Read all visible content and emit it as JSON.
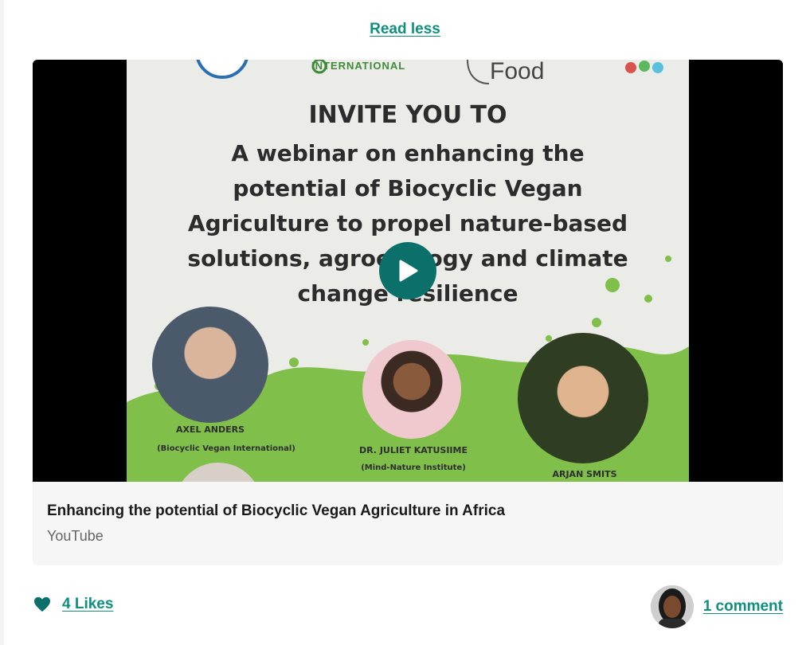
{
  "post": {
    "read_less_label": "Read less"
  },
  "embed": {
    "title": "Enhancing the potential of Biocyclic Vegan Agriculture in Africa",
    "source": "YouTube",
    "poster": {
      "logo_text_1": "INTERNATIONAL",
      "logo_text_2": "Food",
      "heading": "INVITE YOU TO",
      "body_lines": [
        "A webinar on enhancing the",
        "potential of Biocyclic Vegan",
        "Agriculture to propel nature-based",
        "solutions, agroecology and climate",
        "change resilience"
      ],
      "speakers": [
        {
          "name": "AXEL ANDERS",
          "org": "(Biocyclic Vegan International)"
        },
        {
          "name": "DR. JULIET KATUSIIME",
          "org": "(Mind-Nature Institute)"
        },
        {
          "name": "ARJAN SMITS",
          "org": ""
        }
      ]
    },
    "play_icon": "play-icon"
  },
  "footer": {
    "likes_label": "4 Likes",
    "heart_icon": "heart-icon",
    "comments_label": "1 comment"
  },
  "colors": {
    "accent": "#0e8f80",
    "play_button": "#0b6f6a",
    "card_bg": "#f6f6f6"
  }
}
